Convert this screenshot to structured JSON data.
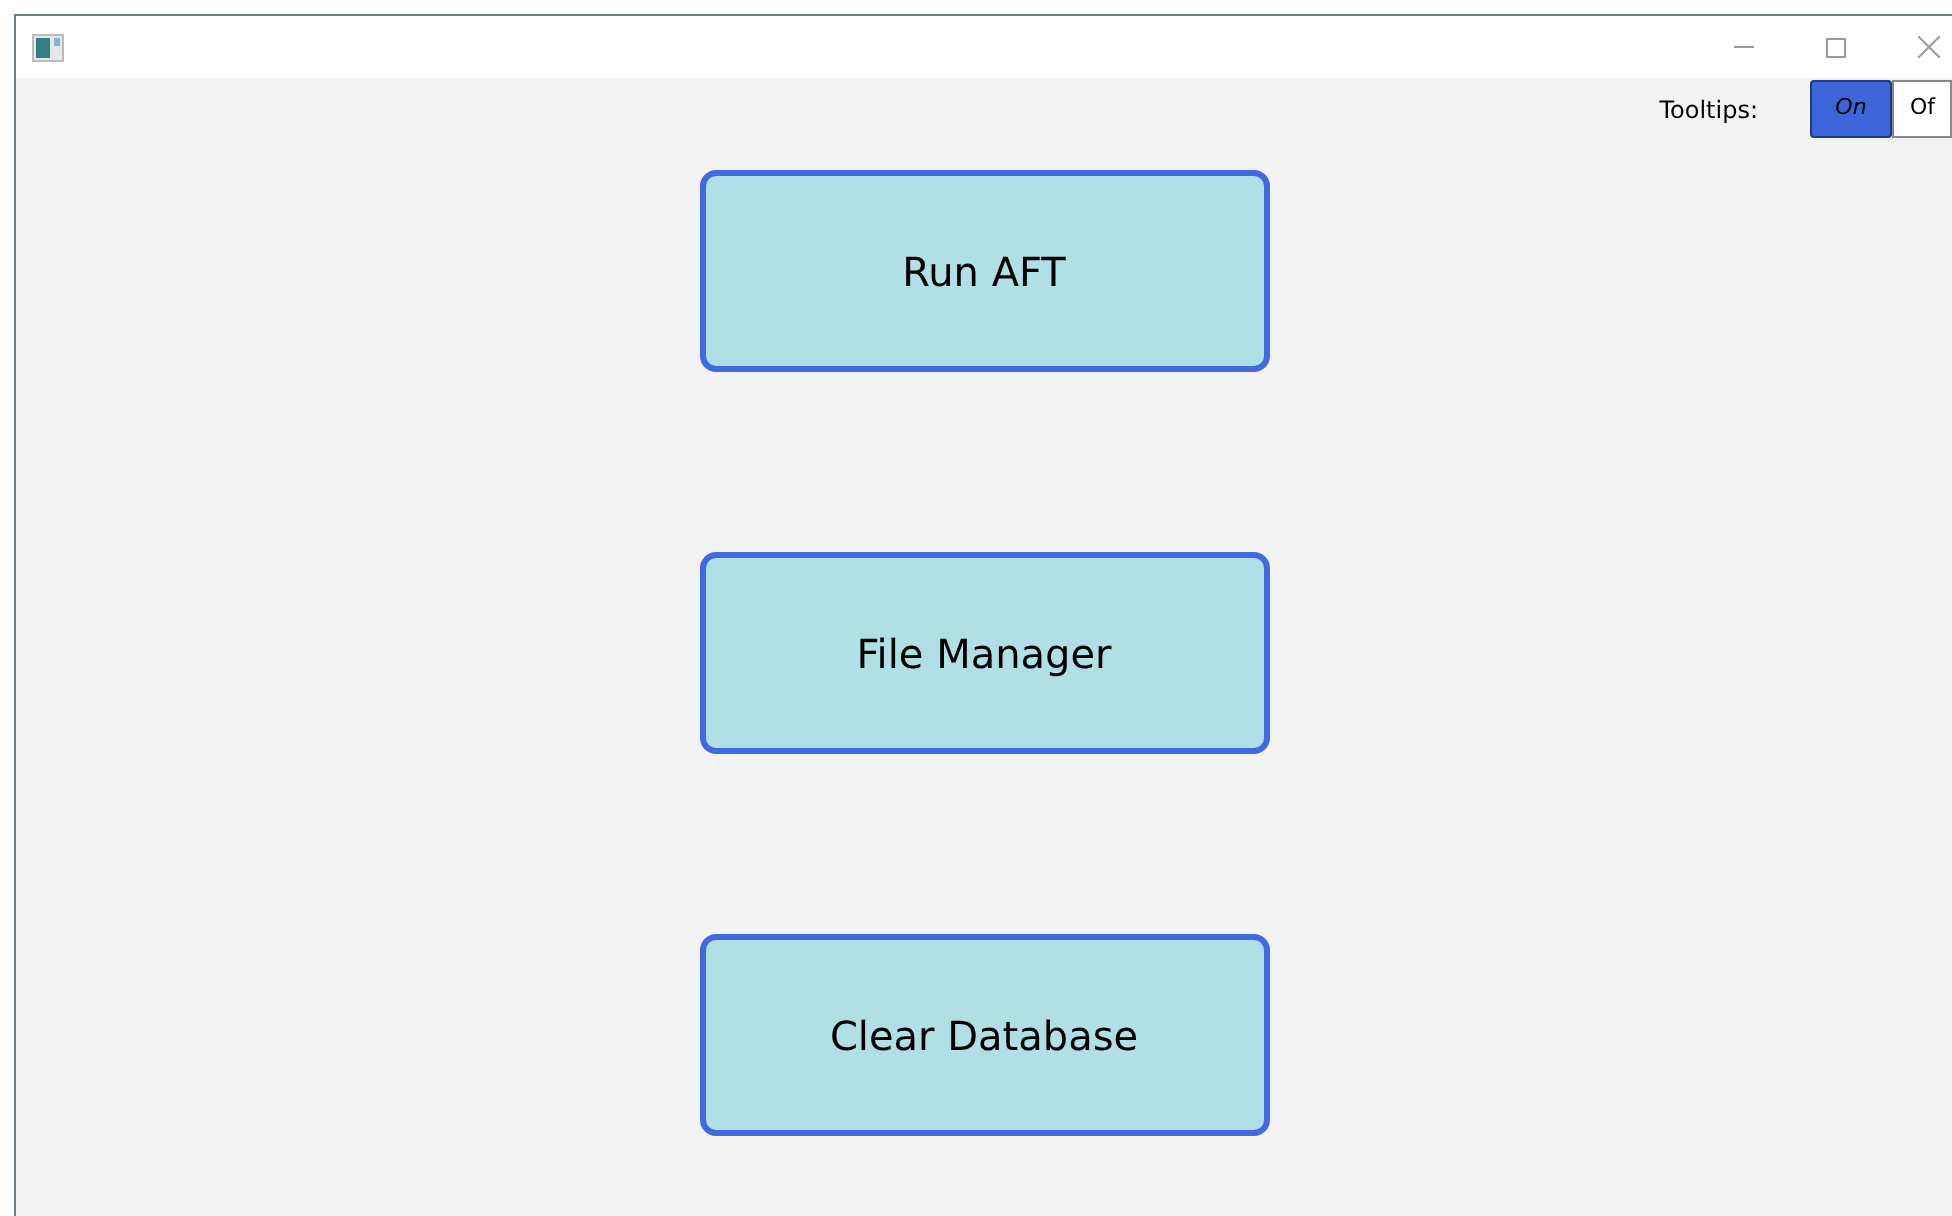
{
  "tooltips": {
    "label": "Tooltips:",
    "options": [
      {
        "label": "On",
        "selected": true
      },
      {
        "label": "Of",
        "selected": false
      }
    ]
  },
  "buttons": [
    "Run AFT",
    "File Manager",
    "Clear Database"
  ]
}
